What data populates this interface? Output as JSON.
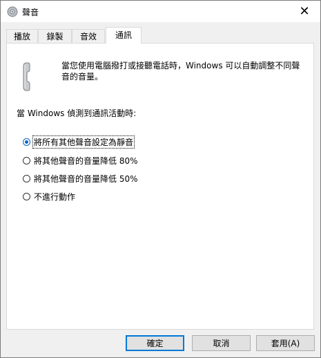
{
  "window": {
    "title": "聲音",
    "close_symbol": "✕"
  },
  "tabs": [
    {
      "label": "播放",
      "active": false
    },
    {
      "label": "錄製",
      "active": false
    },
    {
      "label": "音效",
      "active": false
    },
    {
      "label": "通訊",
      "active": true
    }
  ],
  "communications": {
    "icon": "telephone-handset-icon",
    "description": "當您使用電腦撥打或接聽電話時，Windows 可以自動調整不同聲音的音量。",
    "detect_label": "當 Windows 偵測到通訊活動時:",
    "options": [
      {
        "label": "將所有其他聲音設定為靜音",
        "checked": true
      },
      {
        "label": "將其他聲音的音量降低 80%",
        "checked": false
      },
      {
        "label": "將其他聲音的音量降低 50%",
        "checked": false
      },
      {
        "label": "不進行動作",
        "checked": false
      }
    ]
  },
  "buttons": {
    "ok": "確定",
    "cancel": "取消",
    "apply": "套用(A)"
  },
  "colors": {
    "accent": "#0078d7",
    "panel_bg": "#ffffff",
    "dialog_bg": "#f0f0f0"
  }
}
